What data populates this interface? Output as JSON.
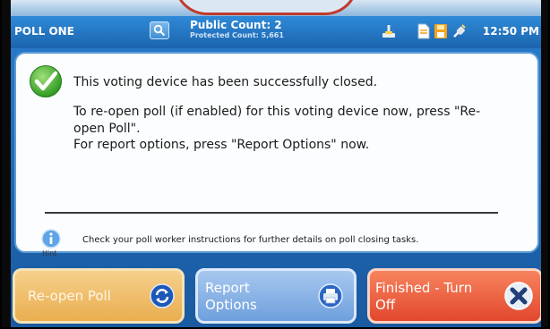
{
  "bezel": {
    "text_right_1": "...",
    "text_right_2": "..."
  },
  "status_bar": {
    "poll_name": "POLL ONE",
    "public_count": "Public Count: 2",
    "protected_count": "Protected Count: 5,661",
    "clock": "12:50 PM",
    "icons": [
      "search-icon",
      "mouse-icon",
      "document-icon",
      "save-icon",
      "power-plug-icon"
    ]
  },
  "dialog": {
    "status_icon": "check-icon",
    "message_closed": "This voting device has been successfully closed.",
    "message_reopen": "To re-open poll (if enabled) for this voting device now, press \"Re-open Poll\".",
    "message_report": "For report options, press \"Report Options\" now.",
    "hint_label": "Hint",
    "hint_text": "Check your poll worker instructions for further details on poll closing tasks."
  },
  "buttons": {
    "reopen_label": "Re-open Poll",
    "report_label": "Report Options",
    "finish_label": "Finished - Turn Off"
  },
  "colors": {
    "reopen": "#e9ae4f",
    "report": "#6f9fdd",
    "finish": "#e2472e",
    "status_bar": "#1f67b3"
  }
}
